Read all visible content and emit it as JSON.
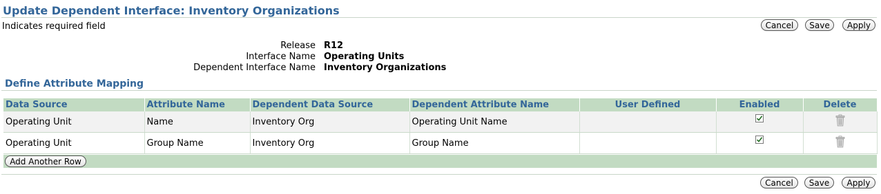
{
  "page": {
    "title": "Update Dependent Interface: Inventory Organizations",
    "required_note": "Indicates required field"
  },
  "buttons": {
    "cancel": "Cancel",
    "save": "Save",
    "apply": "Apply",
    "add_row": "Add Another Row"
  },
  "info": {
    "release_label": "Release",
    "release_value": "R12",
    "interface_label": "Interface Name",
    "interface_value": "Operating Units",
    "dependent_label": "Dependent Interface Name",
    "dependent_value": "Inventory Organizations"
  },
  "mapping": {
    "title": "Define Attribute Mapping",
    "columns": [
      "Data Source",
      "Attribute Name",
      "Dependent Data Source",
      "Dependent Attribute Name",
      "User Defined",
      "Enabled",
      "Delete"
    ],
    "rows": [
      {
        "data_source": "Operating Unit",
        "attribute_name": "Name",
        "dependent_data_source": "Inventory Org",
        "dependent_attribute_name": "Operating Unit Name",
        "user_defined": "",
        "enabled": true
      },
      {
        "data_source": "Operating Unit",
        "attribute_name": "Group Name",
        "dependent_data_source": "Inventory Org",
        "dependent_attribute_name": "Group Name",
        "user_defined": "",
        "enabled": true
      }
    ]
  },
  "colors": {
    "title": "#336699",
    "header_bg": "#c2dbc2",
    "row_alt_bg": "#f2f2f2"
  },
  "icons": {
    "enabled": "checkbox-checked-icon",
    "delete": "trash-icon"
  }
}
